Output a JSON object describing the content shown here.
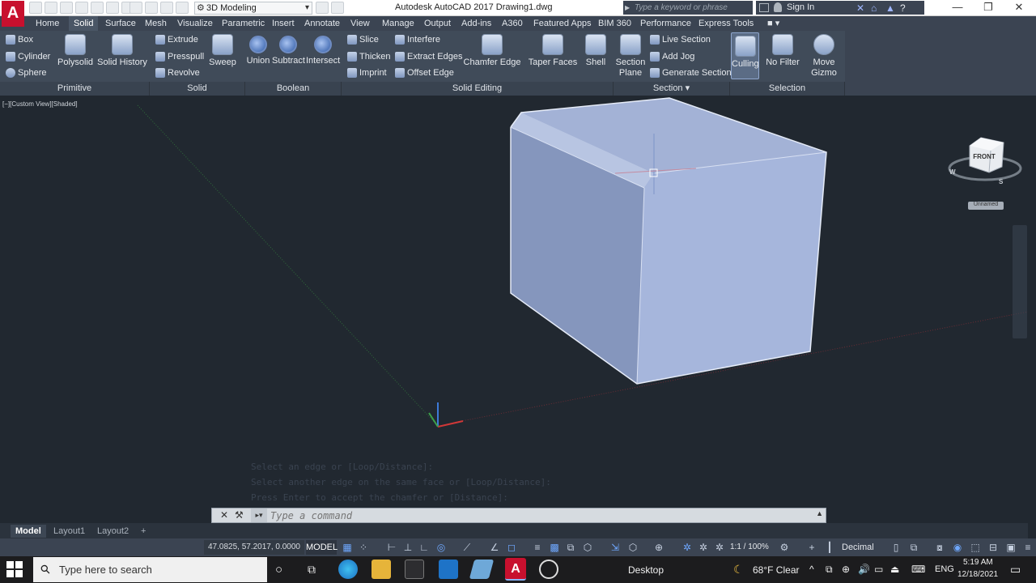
{
  "titlebar": {
    "app_logo": "A",
    "workspace": "3D Modeling",
    "window_title": "Autodesk AutoCAD 2017    Drawing1.dwg",
    "search_placeholder": "Type a keyword or phrase",
    "signin": "Sign In"
  },
  "ribbon": {
    "tabs": [
      "Home",
      "Solid",
      "Surface",
      "Mesh",
      "Visualize",
      "Parametric",
      "Insert",
      "Annotate",
      "View",
      "Manage",
      "Output",
      "Add-ins",
      "A360",
      "Featured Apps",
      "BIM 360",
      "Performance",
      "Express Tools"
    ],
    "active_tab": "Solid",
    "primitive": {
      "box": "Box",
      "cylinder": "Cylinder",
      "sphere": "Sphere",
      "polysolid": "Polysolid",
      "solid_history": "Solid History",
      "panel": "Primitive"
    },
    "solid": {
      "extrude": "Extrude",
      "presspull": "Presspull",
      "revolve": "Revolve",
      "sweep": "Sweep",
      "panel": "Solid"
    },
    "boolean": {
      "union": "Union",
      "subtract": "Subtract",
      "intersect": "Intersect",
      "panel": "Boolean"
    },
    "solid_editing": {
      "slice": "Slice",
      "thicken": "Thicken",
      "imprint": "Imprint",
      "interfere": "Interfere",
      "extract_edges": "Extract Edges",
      "offset_edge": "Offset Edge",
      "chamfer_edge": "Chamfer Edge",
      "taper_faces": "Taper Faces",
      "shell": "Shell",
      "panel": "Solid Editing"
    },
    "section": {
      "section_plane_1": "Section",
      "section_plane_2": "Plane",
      "live_section": "Live Section",
      "add_jog": "Add Jog",
      "generate_section": "Generate Section",
      "panel": "Section ▾"
    },
    "selection": {
      "culling": "Culling",
      "no_filter": "No Filter",
      "move_gizmo_1": "Move",
      "move_gizmo_2": "Gizmo",
      "panel": "Selection"
    }
  },
  "viewport": {
    "label": "[−][Custom View][Shaded]",
    "viewcube_face": "FRONT",
    "viewcube_unnamed": "Unnamed",
    "compass": {
      "w": "W",
      "s": "S"
    },
    "command_history": [
      "Select an edge or [Loop/Distance]:",
      "Select another edge on the same face or [Loop/Distance]:",
      "Press Enter to accept the chamfer or [Distance]:"
    ],
    "command_placeholder": "Type a command"
  },
  "layout_tabs": [
    "Model",
    "Layout1",
    "Layout2"
  ],
  "statusbar": {
    "coords": "47.0825, 57.2017, 0.0000",
    "model": "MODEL",
    "scale": "1:1 / 100%",
    "units": "Decimal"
  },
  "taskbar": {
    "search": "Type here to search",
    "desktop": "Desktop",
    "weather": "68°F  Clear",
    "lang": "ENG",
    "time": "5:19 AM",
    "date": "12/18/2021"
  }
}
